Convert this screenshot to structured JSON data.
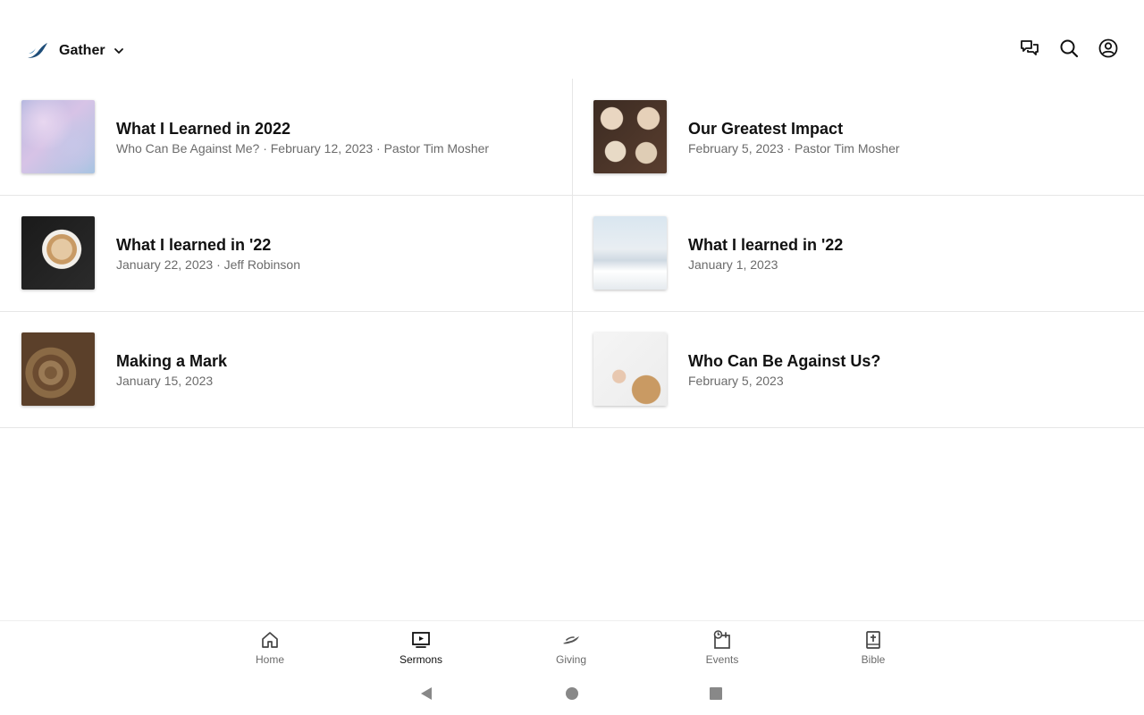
{
  "header": {
    "app_name": "Gather"
  },
  "sermons": [
    {
      "title": "What I Learned in 2022",
      "meta": "Who Can Be Against Me? · February 12, 2023 · Pastor Tim Mosher"
    },
    {
      "title": "Our Greatest Impact",
      "meta": "February 5, 2023 · Pastor Tim Mosher"
    },
    {
      "title": "What I learned in '22",
      "meta": "January 22, 2023 · Jeff Robinson"
    },
    {
      "title": "What I learned in '22",
      "meta": "January 1, 2023"
    },
    {
      "title": "Making a Mark",
      "meta": "January 15, 2023"
    },
    {
      "title": "Who Can Be Against Us?",
      "meta": "February 5, 2023"
    }
  ],
  "bottom_nav": {
    "items": [
      {
        "label": "Home",
        "icon": "home-icon"
      },
      {
        "label": "Sermons",
        "icon": "sermons-icon",
        "active": true
      },
      {
        "label": "Giving",
        "icon": "giving-icon"
      },
      {
        "label": "Events",
        "icon": "events-icon"
      },
      {
        "label": "Bible",
        "icon": "bible-icon"
      }
    ]
  },
  "colors": {
    "brand": "#1f4e79",
    "text": "#111111",
    "muted": "#6b6b6b",
    "divider": "#e6e6e6"
  }
}
